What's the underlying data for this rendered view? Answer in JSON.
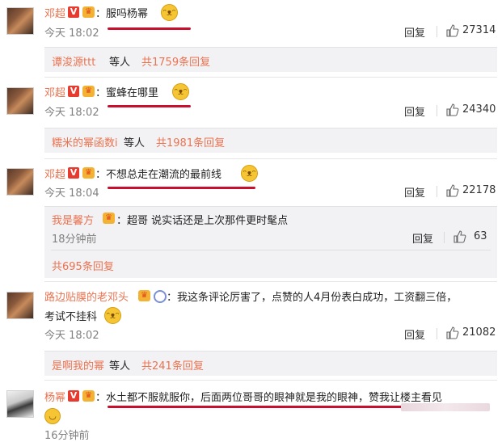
{
  "comments": [
    {
      "name": "邓超",
      "text": "：服吗杨幂",
      "time": "今天 18:02",
      "reply": "回复",
      "likes": "27314",
      "sub": {
        "user": "谭浚源ttt",
        "mid": " 等人 ",
        "count": "共1759条回复"
      }
    },
    {
      "name": "邓超",
      "text": "：蜜蜂在哪里",
      "time": "今天 18:02",
      "reply": "回复",
      "likes": "24340",
      "sub": {
        "user": "糯米的幂函数i",
        "mid": " 等人 ",
        "count": "共1981条回复"
      }
    },
    {
      "name": "邓超",
      "text": "：不想总走在潮流的最前线",
      "time": "今天 18:04",
      "reply": "回复",
      "likes": "22178",
      "sub_reply": {
        "user": "我是馨方",
        "text": "：超哥 说实话还是上次那件更时髦点",
        "time": "18分钟前",
        "reply": "回复",
        "likes": "63"
      },
      "sub_count": "共695条回复"
    },
    {
      "name": "路边贴膜的老邓头",
      "text_line1": "：我这条评论厉害了，点赞的人4月份表白成功，工资翻三倍，",
      "text_line2": "考试不挂科",
      "time": "今天 18:02",
      "reply": "回复",
      "likes": "21082",
      "sub": {
        "user": "是啊我的幂",
        "mid": " 等人 ",
        "count": "共241条回复"
      }
    },
    {
      "name": "杨幂",
      "text": "：水土都不服就服你，后面两位哥哥的眼神就是我的眼神，赞我让楼主看见",
      "time": "16分钟前"
    }
  ],
  "icons": {
    "verified": "V",
    "crown": "♛",
    "emoji": "doge-face-emoji"
  }
}
